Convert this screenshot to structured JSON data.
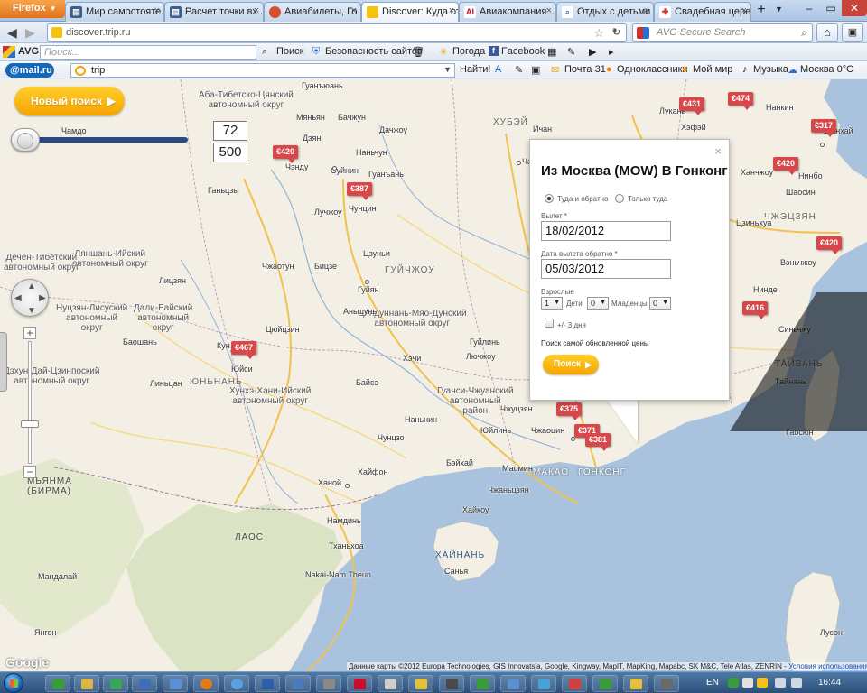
{
  "browser": {
    "menu_label": "Firefox",
    "tabs": [
      {
        "label": "Мир самостояте...",
        "icon": "page-icon",
        "color": "#3a5f8f"
      },
      {
        "label": "Расчет точки вх...",
        "icon": "page-icon",
        "color": "#3a5f8f"
      },
      {
        "label": "Авиабилеты, Го...",
        "icon": "globe-icon",
        "color": "#d94f2a"
      },
      {
        "label": "Discover: Куда от...",
        "icon": "trip-icon",
        "color": "#f5c211",
        "active": true
      },
      {
        "label": "Авиакомпания ...",
        "icon": "ai-icon",
        "color": "#c8102e"
      },
      {
        "label": "Отдых с детьми |...",
        "icon": "search-icon",
        "color": "#4a7bb7"
      },
      {
        "label": "Свадебная цере...",
        "icon": "cross-icon",
        "color": "#e03030"
      }
    ],
    "url": "discover.trip.ru",
    "avg_search_placeholder": "AVG Secure Search"
  },
  "avg_toolbar": {
    "logo": "AVG",
    "search_placeholder": "Поиск...",
    "search_button": "Поиск",
    "security": "Безопасность сайтов",
    "weather": "Погода",
    "facebook": "Facebook"
  },
  "mail_toolbar": {
    "logo": "@mail.ru",
    "query": "trip",
    "find": "Найти!",
    "mail": "Почта 31",
    "odnoklassniki": "Одноклассники",
    "my_world": "Мой мир",
    "music": "Музыка",
    "weather": "Москва 0°C"
  },
  "left_panel": {
    "new_search": "Новый поиск",
    "slider_label": "Чамдо",
    "value_top": "72",
    "value_bottom": "500"
  },
  "popup": {
    "title": "Из Москва (MOW) В Гонконг",
    "round_trip": "Туда и обратно",
    "one_way": "Только туда",
    "depart_label": "Вылет *",
    "depart_value": "18/02/2012",
    "return_label": "Дата вылета обратно *",
    "return_value": "05/03/2012",
    "adults_label": "Взрослые",
    "adults": "1",
    "children_label": "Дети",
    "children": "0",
    "infants_label": "Младенцы",
    "infants": "0",
    "flex_label": "+/- 3 дня",
    "fresh_label": "Поиск самой обновленной цены",
    "search_button": "Поиск",
    "close": "×"
  },
  "map": {
    "prices": [
      {
        "label": "€431"
      },
      {
        "label": "€474"
      },
      {
        "label": "€317"
      },
      {
        "label": "€420"
      },
      {
        "label": "€420"
      },
      {
        "label": "€387"
      },
      {
        "label": "€420"
      },
      {
        "label": "€416"
      },
      {
        "label": "€467"
      },
      {
        "label": "€375"
      },
      {
        "label": "€371"
      },
      {
        "label": "€381"
      }
    ],
    "attribution": "Данные карты ©2012 Europa Technologies, GIS Innovatsia, Google, Kingway, MapIT, MapKing, Mapabc, SK M&C, Tele Atlas, ZENRIN -",
    "terms": "Условия использования",
    "google": "Google"
  },
  "taskbar": {
    "language": "EN",
    "time": "16:44"
  }
}
